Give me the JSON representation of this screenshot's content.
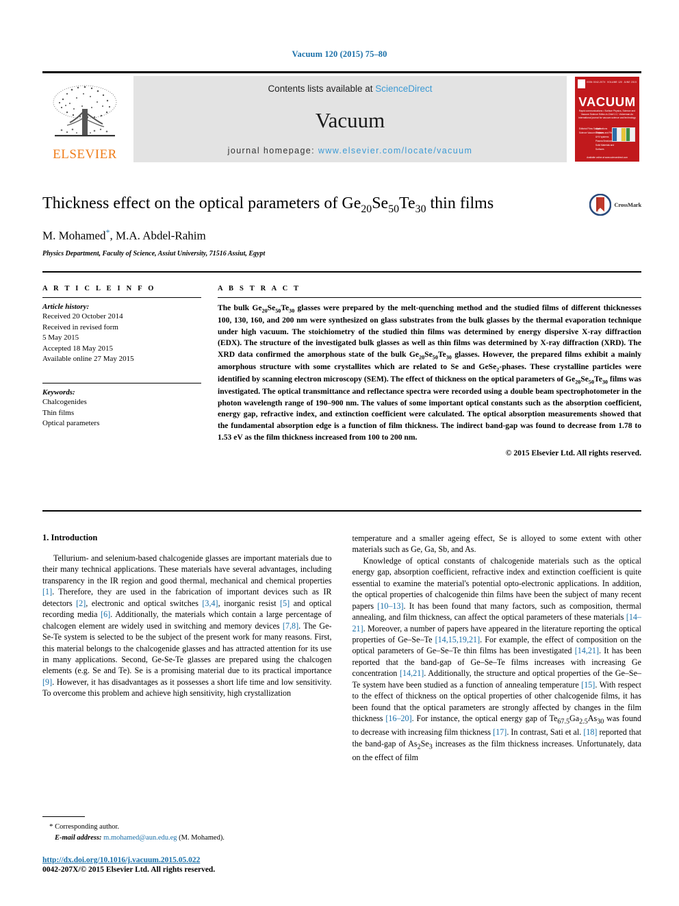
{
  "running_head": "Vacuum 120 (2015) 75–80",
  "masthead": {
    "publisher_name": "ELSEVIER",
    "contents_prefix": "Contents lists available at ",
    "contents_link": "ScienceDirect",
    "journal_name": "Vacuum",
    "homepage_prefix": "journal homepage: ",
    "homepage_url": "www.elsevier.com/locate/vacuum",
    "cover": {
      "title": "VACUUM",
      "top_left_tiny": "ISSN 0042-207X",
      "top_mid_tiny": "VOLUME 120",
      "top_right_tiny": "JUNE 2015",
      "subtitle": "Rapid communications • Surface Physics, Science and Vacuum Science\nEditor-in-Chief\nJ.C. Vickerman\nAn international journal for vacuum science and technology",
      "left_list": "Editorial\nFilms\nSurface Science\nVacuum Physics",
      "mid_list": "Applications\nSurfaces\nand Films\nUHV systems\nPlasma\nBreakdown\nSolid Materials\nand Surfaces",
      "footer": "Available online at www.sciencedirect.com"
    }
  },
  "article": {
    "title_parts": [
      "Thickness effect on the optical parameters of Ge",
      "20",
      "Se",
      "50",
      "Te",
      "30",
      " thin films"
    ],
    "title_plain": "Thickness effect on the optical parameters of Ge20Se50Te30 thin films",
    "authors": "M. Mohamed*, M.A. Abdel-Rahim",
    "author_1": "M. Mohamed",
    "author_2": ", M.A. Abdel-Rahim",
    "affiliation": "Physics Department, Faculty of Science, Assiut University, 71516 Assiut, Egypt",
    "crossmark_label": "CrossMark"
  },
  "article_info": {
    "heading": "A R T I C L E   I N F O",
    "history_label": "Article history:",
    "history_lines": [
      "Received 20 October 2014",
      "Received in revised form",
      "5 May 2015",
      "Accepted 18 May 2015",
      "Available online 27 May 2015"
    ],
    "keywords_label": "Keywords:",
    "keywords": [
      "Chalcogenides",
      "Thin films",
      "Optical parameters"
    ]
  },
  "abstract": {
    "heading": "A B S T R A C T",
    "p1_a": "The bulk Ge",
    "p1_b": "20",
    "p1_c": "Se",
    "p1_d": "50",
    "p1_e": "Te",
    "p1_f": "30",
    "p1_g": " glasses were prepared by the melt-quenching method and the studied films of different thicknesses 100, 130, 160, and 200 nm were synthesized on glass substrates from the bulk glasses by the thermal evaporation technique under high vacuum. The stoichiometry of the studied thin films was determined by energy dispersive X-ray diffraction (EDX). The structure of the investigated bulk glasses as well as thin films was determined by X-ray diffraction (XRD). The XRD data confirmed the amorphous state of the bulk Ge",
    "p1_h": "20",
    "p1_i": "Se",
    "p1_j": "50",
    "p1_k": "Te",
    "p1_l": "30",
    "p1_m": " glasses. However, the prepared films exhibit a mainly amorphous structure with some crystallites which are related to Se and GeSe",
    "p1_n": "2",
    "p1_o": "-phases. These crystalline particles were identified by scanning electron microscopy (SEM). The effect of thickness on the optical parameters of Ge",
    "p1_p": "20",
    "p1_q": "Se",
    "p1_r": "50",
    "p1_s": "Te",
    "p1_t": "30",
    "p1_u": " films was investigated. The optical transmittance and reflectance spectra were recorded using a double beam spectrophotometer in the photon wavelength range of 190–900 nm. The values of some important optical constants such as the absorption coefficient, energy gap, refractive index, and extinction coefficient were calculated. The optical absorption measurements showed that the fundamental absorption edge is a function of film thickness. The indirect band-gap was found to decrease from 1.78 to 1.53 eV as the film thickness increased from 100 to 200 nm.",
    "copyright": "© 2015 Elsevier Ltd. All rights reserved."
  },
  "introduction": {
    "heading": "1.  Introduction",
    "left_p1_s1": "Tellurium- and selenium-based chalcogenide glasses are important materials due to their many technical applications. These materials have several advantages, including transparency in the IR region and good thermal, mechanical and chemical properties ",
    "left_r1": "[1]",
    "left_p1_s2": ". Therefore, they are used in the fabrication of important devices such as IR detectors ",
    "left_r2": "[2]",
    "left_p1_s3": ", electronic and optical switches ",
    "left_r3": "[3,4]",
    "left_p1_s4": ", inorganic resist ",
    "left_r4": "[5]",
    "left_p1_s5": " and optical recording media ",
    "left_r5": "[6]",
    "left_p1_s6": ". Additionally, the materials which contain a large percentage of chalcogen element are widely used in switching and memory devices ",
    "left_r6": "[7,8]",
    "left_p1_s7": ". The Ge-Se-Te system is selected to be the subject of the present work for many reasons. First, this material belongs to the chalcogenide glasses and has attracted attention for its use in many applications. Second, Ge-Se-Te glasses are prepared using the chalcogen elements (e.g. Se and Te). Se is a promising material due to its practical importance ",
    "left_r7": "[9]",
    "left_p1_s8": ". However, it has disadvantages as it possesses a short life time and low sensitivity. To overcome this problem and achieve high sensitivity, high crystallization",
    "right_p1": "temperature and a smaller ageing effect, Se is alloyed to some extent with other materials such as Ge, Ga, Sb, and As.",
    "right_p2_s1": "Knowledge of optical constants of chalcogenide materials such as the optical energy gap, absorption coefficient, refractive index and extinction coefficient is quite essential to examine the material's potential opto-electronic applications. In addition, the optical properties of chalcogenide thin films have been the subject of many recent papers ",
    "right_r1": "[10–13]",
    "right_p2_s2": ". It has been found that many factors, such as composition, thermal annealing, and film thickness, can affect the optical parameters of these materials ",
    "right_r2": "[14–21]",
    "right_p2_s3": ". Moreover, a number of papers have appeared in the literature reporting the optical properties of Ge–Se–Te ",
    "right_r3": "[14,15,19,21]",
    "right_p2_s4": ". For example, the effect of composition on the optical parameters of Ge–Se–Te thin films has been investigated ",
    "right_r4": "[14,21]",
    "right_p2_s5": ". It has been reported that the band-gap of Ge–Se–Te films increases with increasing Ge concentration ",
    "right_r5": "[14,21]",
    "right_p2_s6": ". Additionally, the structure and optical properties of the Ge–Se–Te system have been studied as a function of annealing temperature ",
    "right_r6": "[15]",
    "right_p2_s7": ". With respect to the effect of thickness on the optical properties of other chalcogenide films, it has been found that the optical parameters are strongly affected by changes in the film thickness ",
    "right_r7": "[16–20]",
    "right_p2_s8": ". For instance, the optical energy gap of Te",
    "right_sub1": "67.5",
    "right_p2_s9": "Ga",
    "right_sub2": "2.5",
    "right_p2_s10": "As",
    "right_sub3": "30",
    "right_p2_s11": " was found to decrease with increasing film thickness ",
    "right_r8": "[17]",
    "right_p2_s12": ". In contrast, Sati et al. ",
    "right_r9": "[18]",
    "right_p2_s13": " reported that the band-gap of As",
    "right_sub4": "2",
    "right_p2_s14": "Se",
    "right_sub5": "3",
    "right_p2_s15": " increases as the film thickness increases. Unfortunately, data on the effect of film"
  },
  "footnote": {
    "corresponding": "Corresponding author.",
    "email_label": "E-mail address:",
    "email": "m.mohamed@aun.edu.eg",
    "email_suffix": " (M. Mohamed)."
  },
  "footer": {
    "doi": "http://dx.doi.org/10.1016/j.vacuum.2015.05.022",
    "issn_line": "0042-207X/© 2015 Elsevier Ltd. All rights reserved."
  },
  "colors": {
    "link_blue": "#1a6fa8",
    "sciencedirect_blue": "#3c9ad4",
    "elsevier_orange": "#ef7d1a",
    "cover_red": "#c1191c",
    "band_gray": "#e3e3e3"
  }
}
